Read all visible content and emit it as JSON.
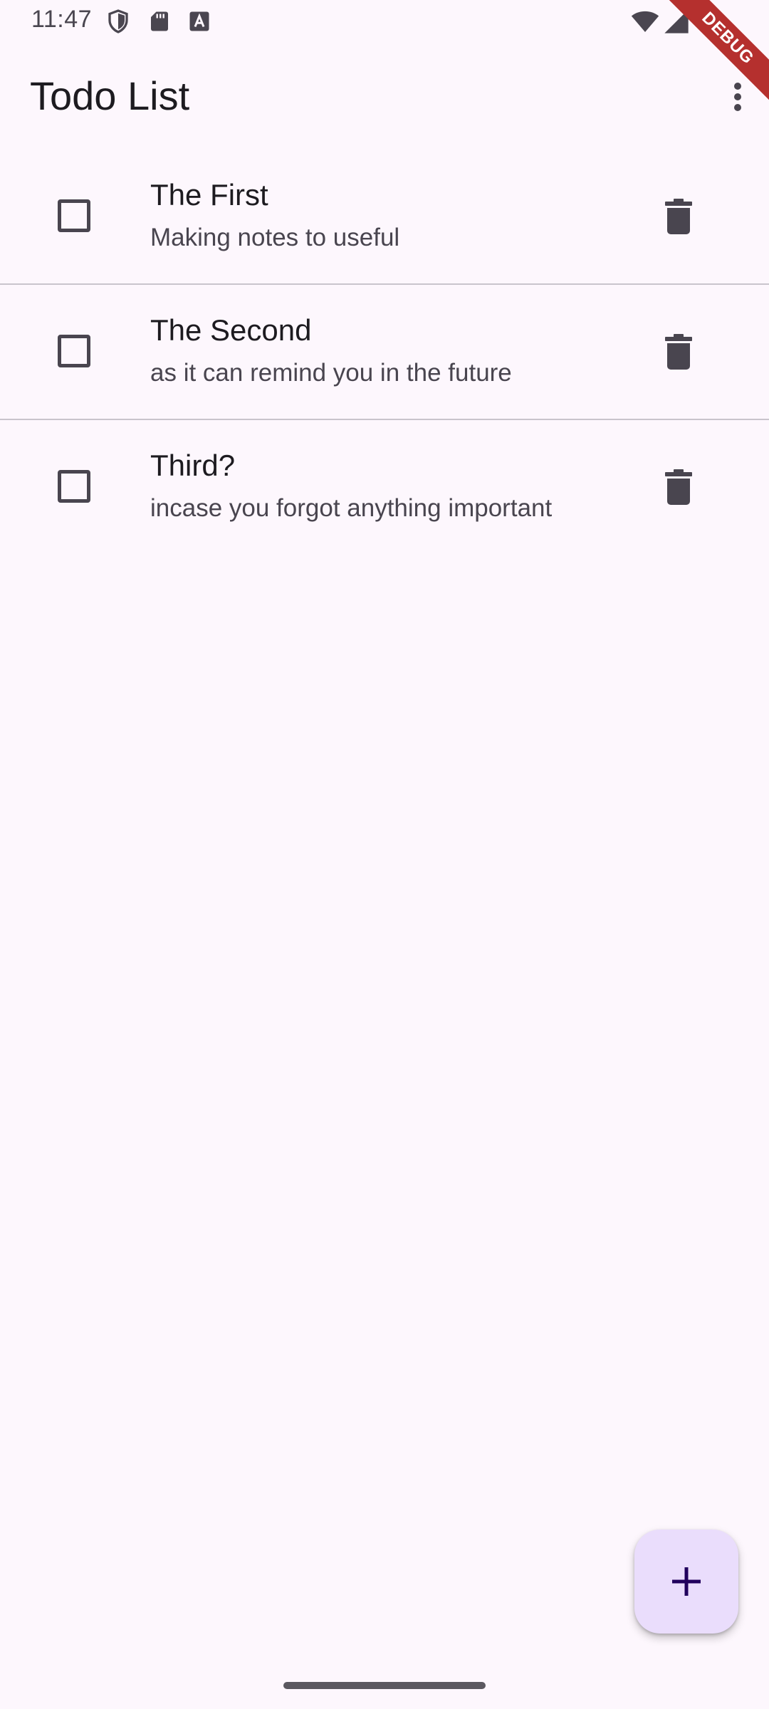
{
  "status_bar": {
    "time": "11:47",
    "left_icons": [
      "shield-icon",
      "sd-card-icon",
      "font-a-icon"
    ],
    "right_icons": [
      "wifi-icon",
      "cell-signal-icon"
    ]
  },
  "debug_banner": {
    "label": "DEBUG",
    "color": "#b5302e"
  },
  "app_bar": {
    "title": "Todo List",
    "menu_icon": "more-vert-icon"
  },
  "todos": [
    {
      "title": "The First",
      "subtitle": "Making notes to useful",
      "checked": false
    },
    {
      "title": "The Second",
      "subtitle": "as it can remind you in the future",
      "checked": false
    },
    {
      "title": "Third?",
      "subtitle": "incase you forgot anything important",
      "checked": false
    }
  ],
  "fab": {
    "icon": "plus-icon",
    "color": "#eaddfc"
  },
  "theme": {
    "background": "#fdf7fd",
    "text_primary": "#1d1b20",
    "text_secondary": "#49454f",
    "divider": "#c9c4cc"
  }
}
